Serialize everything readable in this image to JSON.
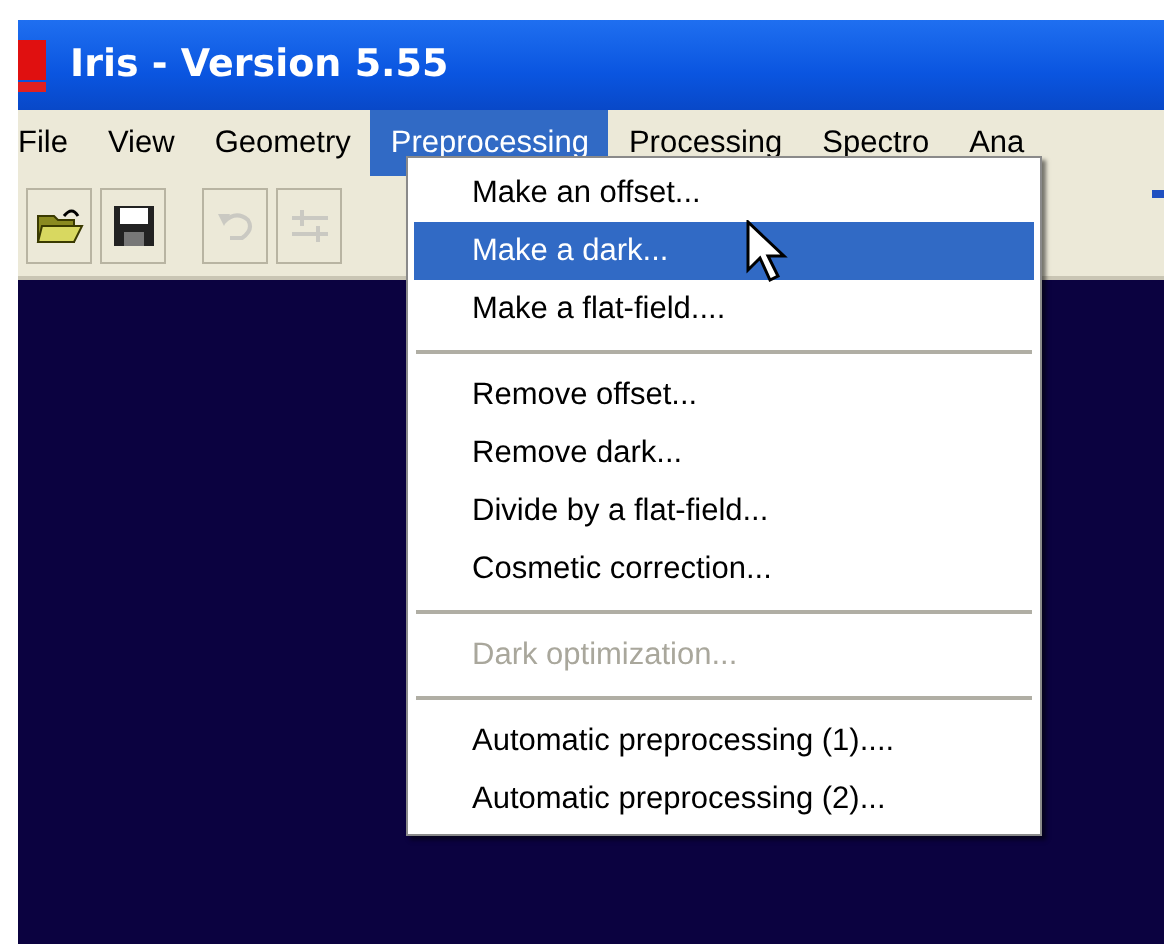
{
  "window": {
    "title": "Iris - Version 5.55"
  },
  "menu_bar": [
    {
      "label": "File",
      "selected": false
    },
    {
      "label": "View",
      "selected": false
    },
    {
      "label": "Geometry",
      "selected": false
    },
    {
      "label": "Preprocessing",
      "selected": true
    },
    {
      "label": "Processing",
      "selected": false
    },
    {
      "label": "Spectro",
      "selected": false
    },
    {
      "label": "Ana",
      "selected": false
    }
  ],
  "toolbar": [
    {
      "kind": "open",
      "disabled": false
    },
    {
      "kind": "save",
      "disabled": false
    },
    {
      "kind": "undo",
      "disabled": true
    },
    {
      "kind": "adjust",
      "disabled": true
    }
  ],
  "dropdown": {
    "items": [
      {
        "kind": "item",
        "label": "Make an offset...",
        "selected": false,
        "disabled": false
      },
      {
        "kind": "item",
        "label": "Make a dark...",
        "selected": true,
        "disabled": false
      },
      {
        "kind": "item",
        "label": "Make a flat-field....",
        "selected": false,
        "disabled": false
      },
      {
        "kind": "separator"
      },
      {
        "kind": "item",
        "label": "Remove offset...",
        "selected": false,
        "disabled": false
      },
      {
        "kind": "item",
        "label": "Remove dark...",
        "selected": false,
        "disabled": false
      },
      {
        "kind": "item",
        "label": "Divide by a flat-field...",
        "selected": false,
        "disabled": false
      },
      {
        "kind": "item",
        "label": "Cosmetic correction...",
        "selected": false,
        "disabled": false
      },
      {
        "kind": "separator"
      },
      {
        "kind": "item",
        "label": "Dark optimization...",
        "selected": false,
        "disabled": true
      },
      {
        "kind": "separator"
      },
      {
        "kind": "item",
        "label": "Automatic preprocessing (1)....",
        "selected": false,
        "disabled": false
      },
      {
        "kind": "item",
        "label": "Automatic preprocessing (2)...",
        "selected": false,
        "disabled": false
      }
    ]
  }
}
